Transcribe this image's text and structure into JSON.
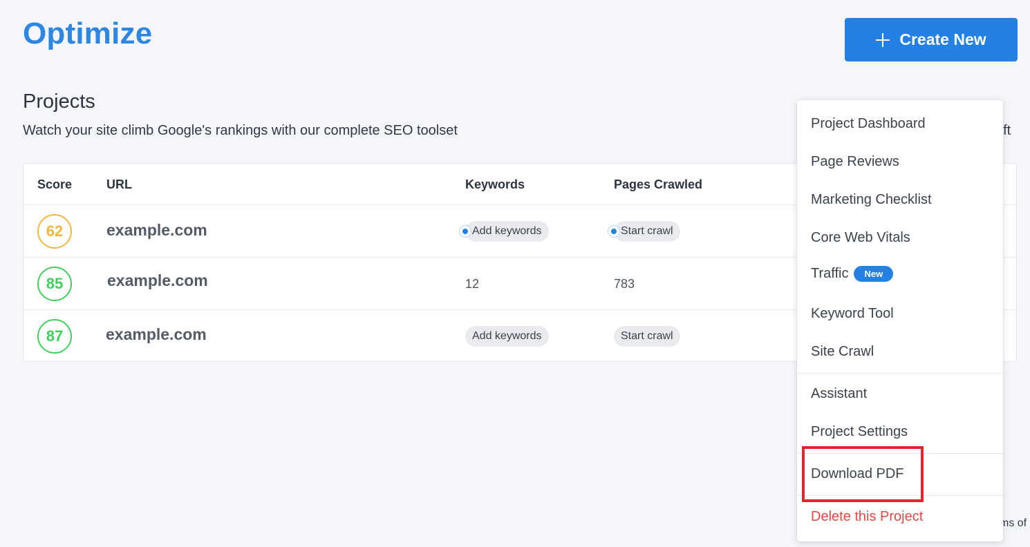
{
  "header": {
    "app_title": "Optimize",
    "create_button_label": "Create New"
  },
  "section": {
    "title": "Projects",
    "subtitle": "Watch your site climb Google's rankings with our complete SEO toolset",
    "right_fragment": "eft",
    "bottom_fragment": "ms of"
  },
  "table": {
    "columns": [
      "Score",
      "URL",
      "Keywords",
      "Pages Crawled"
    ],
    "rows": [
      {
        "score": "62",
        "score_color": "#f3b63e",
        "url": "example.com",
        "keywords": "Add keywords",
        "pages_crawled": "Start crawl"
      },
      {
        "score": "85",
        "score_color": "#3fcf5a",
        "url": "example.com",
        "keywords": "12",
        "pages_crawled": "783"
      },
      {
        "score": "87",
        "score_color": "#3fcf5a",
        "url": "example.com",
        "keywords": "Add keywords",
        "pages_crawled": "Start crawl"
      }
    ]
  },
  "menu": {
    "items": [
      {
        "label": "Project Dashboard"
      },
      {
        "label": "Page Reviews"
      },
      {
        "label": "Marketing Checklist"
      },
      {
        "label": "Core Web Vitals"
      },
      {
        "label": "Traffic",
        "badge": "New"
      },
      {
        "label": "Keyword Tool"
      },
      {
        "label": "Site Crawl"
      },
      {
        "label": "Assistant"
      },
      {
        "label": "Project Settings"
      },
      {
        "label": "Download PDF"
      },
      {
        "label": "Delete this Project"
      }
    ]
  },
  "colors": {
    "accent": "#2381e4",
    "score_warning": "#f3b63e",
    "score_good": "#3fcf5a",
    "danger": "#e94545",
    "highlight": "#e3262b"
  }
}
